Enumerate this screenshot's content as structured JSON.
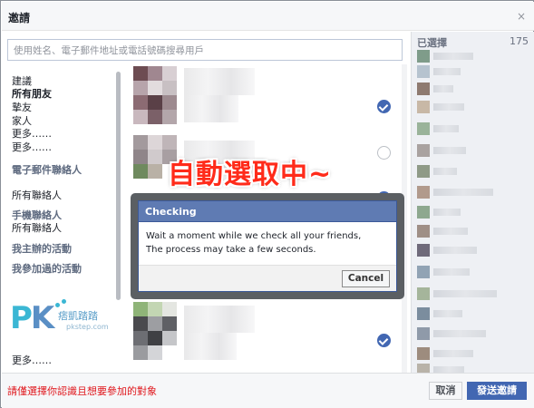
{
  "dialog": {
    "title": "邀請",
    "close_glyph": "×",
    "search_placeholder": "使用姓名、電子郵件地址或電話號碼搜尋用戶"
  },
  "categories": {
    "friends": [
      "建議",
      "所有朋友",
      "摯友",
      "家人",
      "更多……",
      "更多……"
    ],
    "email_head": "電子郵件聯絡人",
    "email_item": "所有聯絡人",
    "phone_head": "手機聯絡人",
    "phone_item": "所有聯絡人",
    "hosted": "我主辦的活動",
    "attended": "我參加過的活動",
    "more_bottom": "更多……"
  },
  "selected_panel": {
    "label": "已選擇",
    "count": "175"
  },
  "overlay_heading": "自動選取中~",
  "checking_dialog": {
    "title": "Checking",
    "message_line1": "Wait a moment while we check all your friends,",
    "message_line2": "The process may take a few seconds.",
    "cancel_label": "Cancel"
  },
  "watermark": {
    "logo_p": "P",
    "logo_k": "K",
    "name": "痞凱踏踏",
    "url": "pkstep.com"
  },
  "footer": {
    "hint": "請僅選擇你認識且想要參加的對象",
    "cancel_label": "取消",
    "send_label": "發送邀請"
  },
  "colors": {
    "accent": "#4267b2",
    "overlay_text": "#ff2b1a",
    "hint_text": "#e0161c",
    "dialog_header": "#5f7bb3"
  },
  "friend_list": {
    "checkbox_states": [
      "checked",
      "unchecked",
      "checked",
      "checked"
    ]
  }
}
